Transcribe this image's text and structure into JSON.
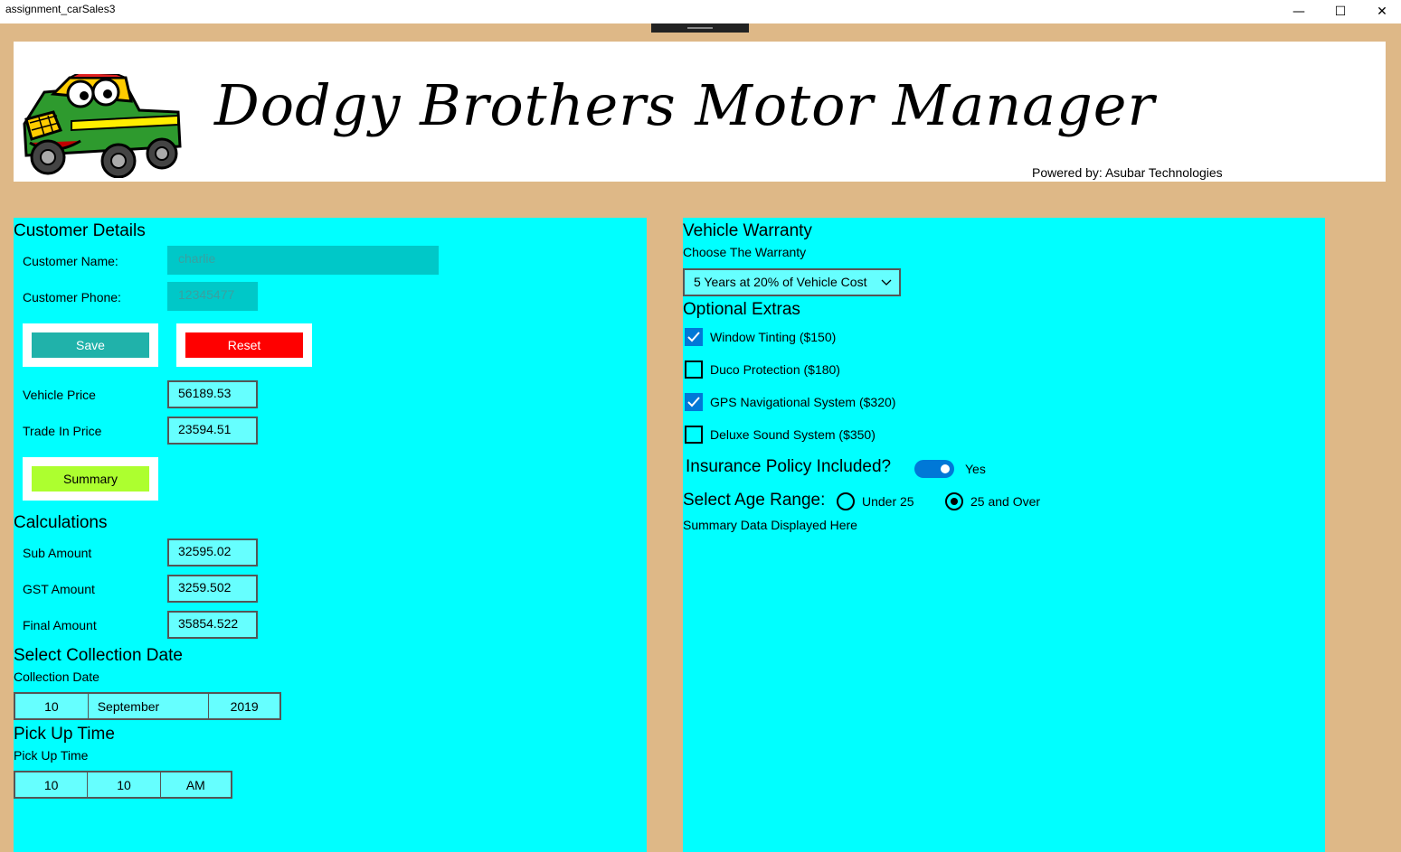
{
  "window": {
    "title": "assignment_carSales3",
    "minimize_glyph": "—",
    "maximize_glyph": "☐",
    "close_glyph": "✕"
  },
  "banner": {
    "title": "Dodgy Brothers Motor Manager",
    "powered_by": "Powered by: Asubar Technologies",
    "logo_icon": "cartoon-truck-logo"
  },
  "customer": {
    "heading": "Customer Details",
    "name_label": "Customer Name:",
    "name_value": "charlie",
    "phone_label": "Customer Phone:",
    "phone_value": "12345477",
    "save_label": "Save",
    "reset_label": "Reset",
    "vehicle_price_label": "Vehicle Price",
    "vehicle_price_value": "56189.53",
    "trade_in_label": "Trade In Price",
    "trade_in_value": "23594.51",
    "summary_label": "Summary"
  },
  "calculations": {
    "heading": "Calculations",
    "sub_label": "Sub Amount",
    "sub_value": "32595.02",
    "gst_label": "GST Amount",
    "gst_value": "3259.502",
    "final_label": "Final Amount",
    "final_value": "35854.522"
  },
  "collection": {
    "heading": "Select Collection Date",
    "label": "Collection Date",
    "day": "10",
    "month": "September",
    "year": "2019"
  },
  "pickup": {
    "heading": "Pick Up Time",
    "label": "Pick Up Time",
    "hour": "10",
    "minute": "10",
    "period": "AM"
  },
  "warranty": {
    "heading": "Vehicle Warranty",
    "label": "Choose The Warranty",
    "selected": "5 Years at 20% of Vehicle Cost"
  },
  "extras": {
    "heading": "Optional Extras",
    "items": [
      {
        "label": "Window Tinting ($150)",
        "checked": true
      },
      {
        "label": "Duco Protection ($180)",
        "checked": false
      },
      {
        "label": "GPS Navigational System ($320)",
        "checked": true
      },
      {
        "label": "Deluxe Sound System ($350)",
        "checked": false
      }
    ]
  },
  "insurance": {
    "label": "Insurance Policy Included?",
    "state": "Yes",
    "on": true
  },
  "age": {
    "label": "Select Age Range:",
    "options": [
      "Under 25",
      "25 and Over"
    ],
    "selected_index": 1
  },
  "summary_output": "Summary Data Displayed Here",
  "colors": {
    "background": "#deb887",
    "panel": "#00ffff",
    "save": "#20b2aa",
    "reset": "#ff0000",
    "summary": "#adff2f",
    "accent": "#0078d7"
  }
}
